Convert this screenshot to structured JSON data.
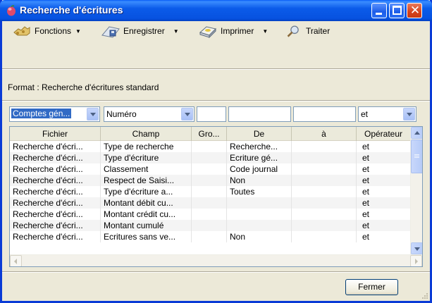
{
  "window": {
    "title": "Recherche d'écritures"
  },
  "toolbar": {
    "fonctions_label": "Fonctions",
    "enregistrer_label": "Enregistrer",
    "imprimer_label": "Imprimer",
    "traiter_label": "Traiter"
  },
  "format_text": "Format : Recherche d'écritures standard",
  "filters": {
    "field1": "Comptes gén...",
    "field2": "Numéro",
    "field3": "",
    "field4": "",
    "field5": "",
    "operator": "et"
  },
  "table": {
    "columns": [
      "Fichier",
      "Champ",
      "Gro...",
      "De",
      "à",
      "Opérateur"
    ],
    "rows": [
      [
        "Recherche d'écri...",
        "Type de recherche",
        "",
        "Recherche...",
        "",
        "et"
      ],
      [
        "Recherche d'écri...",
        "Type d'écriture",
        "",
        "Ecriture gé...",
        "",
        "et"
      ],
      [
        "Recherche d'écri...",
        "Classement",
        "",
        "Code journal",
        "",
        "et"
      ],
      [
        "Recherche d'écri...",
        "Respect de Saisi...",
        "",
        "Non",
        "",
        "et"
      ],
      [
        "Recherche d'écri...",
        "Type d'écriture a...",
        "",
        "Toutes",
        "",
        "et"
      ],
      [
        "Recherche d'écri...",
        "Montant débit cu...",
        "",
        "",
        "",
        "et"
      ],
      [
        "Recherche d'écri...",
        "Montant crédit cu...",
        "",
        "",
        "",
        "et"
      ],
      [
        "Recherche d'écri...",
        "Montant cumulé",
        "",
        "",
        "",
        "et"
      ],
      [
        "Recherche d'écri...",
        "Ecritures sans ve...",
        "",
        "Non",
        "",
        "et"
      ]
    ]
  },
  "buttons": {
    "fermer": "Fermer"
  }
}
